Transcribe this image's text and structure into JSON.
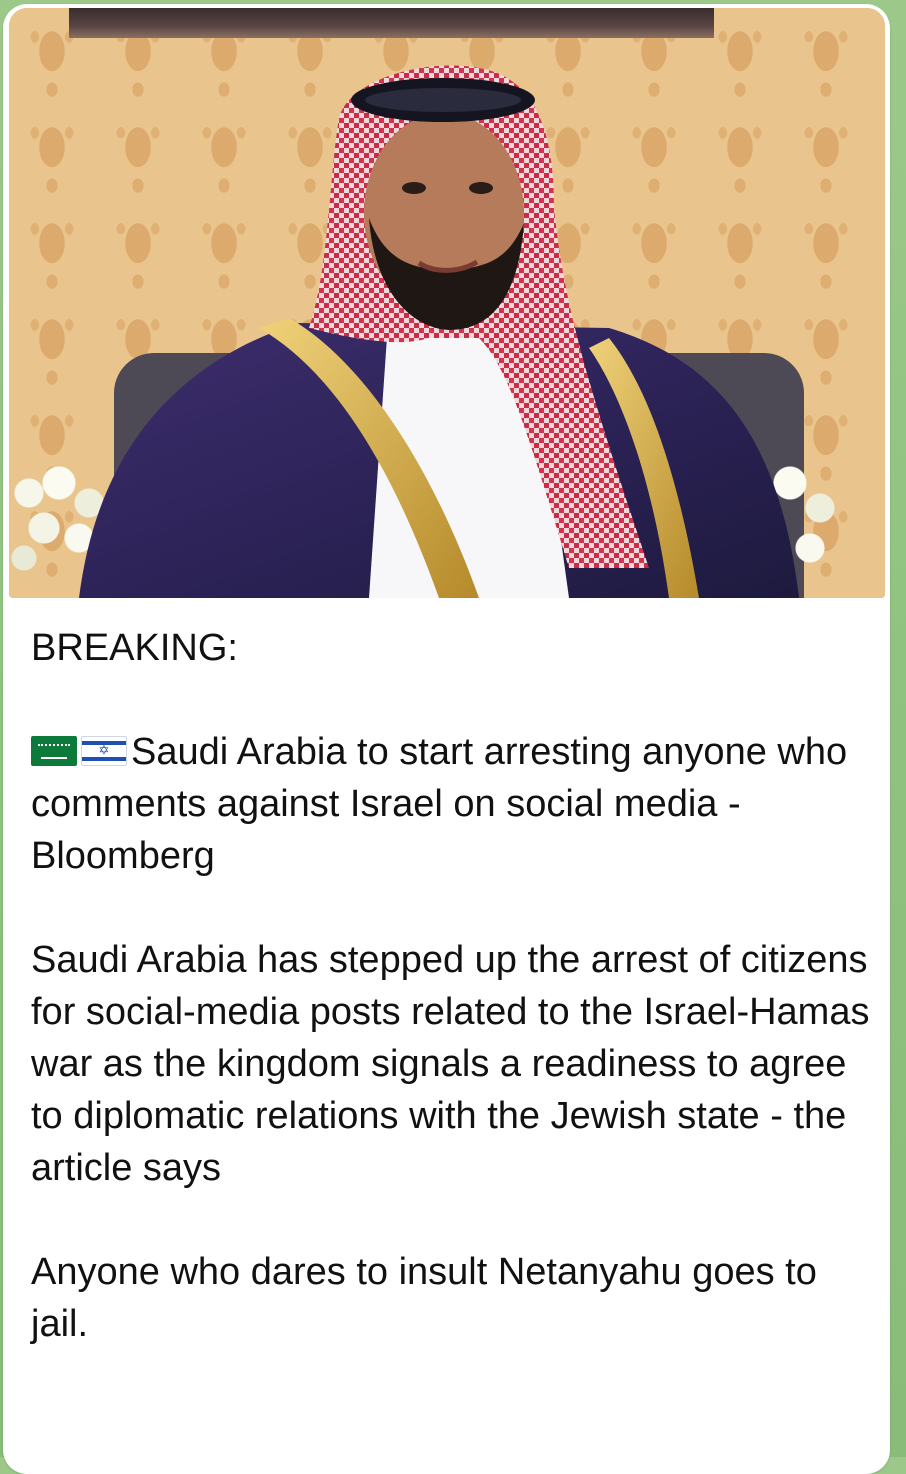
{
  "message": {
    "photo_alt": "Saudi crown prince in traditional attire",
    "text": {
      "heading": "BREAKING:",
      "flags": [
        "saudi-arabia-flag",
        "israel-flag"
      ],
      "headline": "Saudi Arabia to start arresting anyone who comments against Israel on social media - Bloomberg",
      "body": "Saudi Arabia has stepped up the arrest of citizens for social-media posts related to the Israel-Hamas war as the kingdom signals a readiness to agree to diplomatic relations with the Jewish state - the article says",
      "closing": "Anyone who dares to insult Netanyahu goes to jail."
    }
  },
  "colors": {
    "chat_background": "#9cc98a",
    "bubble": "#ffffff",
    "text": "#111111",
    "saudi_green": "#0d7a3c",
    "israel_blue": "#1d4fb5"
  }
}
